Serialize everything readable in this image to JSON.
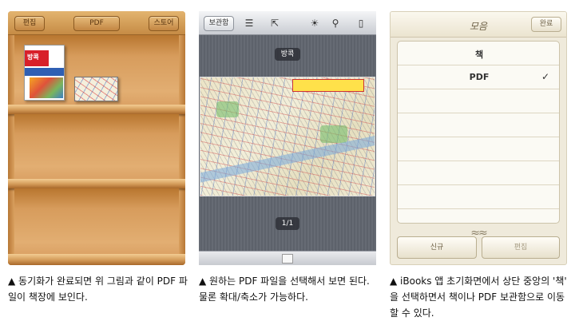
{
  "panel1": {
    "left_button": "편집",
    "center_button": "PDF",
    "right_button": "스토어",
    "book_title": "방콕",
    "caption": "▲ 동기화가 완료되면 위 그림과 같이 PDF 파일이 책장에 보인다."
  },
  "panel2": {
    "library_button": "보관함",
    "doc_title": "방콕",
    "page_indicator": "1/1",
    "caption": "▲ 원하는 PDF 파일을 선택해서 보면 된다. 물론 확대/축소가 가능하다."
  },
  "panel3": {
    "title": "모음",
    "done_button": "완료",
    "items": [
      {
        "label": "책",
        "checked": false
      },
      {
        "label": "PDF",
        "checked": true
      }
    ],
    "checkmark": "✓",
    "new_button": "신규",
    "edit_button": "편집",
    "caption": "▲ iBooks 앱 초기화면에서 상단 중앙의 '책' 을 선택하면서 책이나 PDF 보관함으로 이동할 수 있다."
  }
}
